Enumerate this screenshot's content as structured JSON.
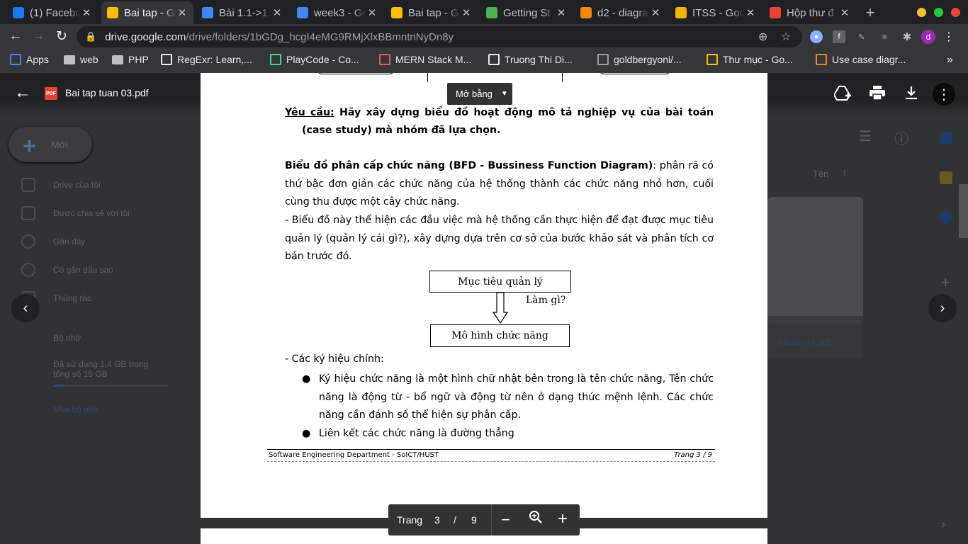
{
  "tabs": [
    {
      "title": "(1) Facebo",
      "icon": "facebook-icon",
      "color": "#1877f2"
    },
    {
      "title": "Bai tap - G",
      "icon": "google-drive-icon",
      "color": "#fbbc04",
      "active": true
    },
    {
      "title": "Bài 1.1->1.",
      "icon": "google-docs-icon",
      "color": "#4285f4"
    },
    {
      "title": "week3 - Go",
      "icon": "google-docs-icon",
      "color": "#4285f4"
    },
    {
      "title": "Bai tap - G",
      "icon": "google-drive-icon",
      "color": "#fbbc04"
    },
    {
      "title": "Getting St",
      "icon": "leaf-icon",
      "color": "#4caf50"
    },
    {
      "title": "d2 - diagra",
      "icon": "drawio-icon",
      "color": "#f08705"
    },
    {
      "title": "ITSS - Goo",
      "icon": "google-slides-icon",
      "color": "#f4b400"
    },
    {
      "title": "Hộp thư đ",
      "icon": "gmail-icon",
      "color": "#ea4335"
    }
  ],
  "address": {
    "url_host": "drive.google.com",
    "url_path": "/drive/folders/1bGDg_hcgI4eMG9RMjXlxBBmntnNyDn8y"
  },
  "bookmarks": [
    {
      "label": "Apps",
      "icon": "apps-grid-icon"
    },
    {
      "label": "web",
      "icon": "folder-icon"
    },
    {
      "label": "PHP",
      "icon": "folder-icon"
    },
    {
      "label": "RegExr: Learn,...",
      "icon": "regexr-icon"
    },
    {
      "label": "PlayCode - Co...",
      "icon": "playcode-icon"
    },
    {
      "label": "MERN Stack M...",
      "icon": "udemy-icon"
    },
    {
      "label": "Truong Thi Di...",
      "icon": "globe-icon"
    },
    {
      "label": "goldbergyoni/...",
      "icon": "github-icon"
    },
    {
      "label": "Thư mục - Go...",
      "icon": "google-drive-icon"
    },
    {
      "label": "Use case diagr...",
      "icon": "lucidchart-icon"
    }
  ],
  "viewer": {
    "file_name": "Bai tap tuan 03.pdf",
    "open_with": "Mở bằng"
  },
  "drive_sidebar": {
    "new_label": "Mới",
    "items": [
      "Drive của tôi",
      "Được chia sẻ với tôi",
      "Gần đây",
      "Có gắn dấu sao",
      "Thùng rác"
    ],
    "storage_label": "Bộ nhớ",
    "storage_text": "Đã sử dụng 1,4 GB trong tổng số 15 GB",
    "buy_storage": "Mua bộ nhớ",
    "storage_fraction": 0.093
  },
  "drive_main": {
    "sort_label": "Tên",
    "file_caption": "p tuan 03.pdf"
  },
  "pdf": {
    "req_label": "Yêu cầu:",
    "req_text": " Hãy xây dựng biểu đồ hoạt động mô tả nghiệp vụ của bài toán (case study) mà nhóm đã lựa chọn.",
    "bfd_title": "Biểu đồ phân cấp chức năng (BFD - Bussiness Function Diagram)",
    "bfd_text": ": phân rã có thứ bậc đơn giản các chức năng của hệ thống thành các chức năng nhỏ hơn, cuối cùng thu được một cây chức năng.",
    "para2": "- Biểu đồ này thể hiện các đầu việc mà hệ thống cần thực hiện để đạt được mục tiêu quản lý (quản lý cái gì?), xây dựng dựa trên cơ sở của bước khảo sát và phân tích cơ bản trước đó.",
    "fig_top": "Mục tiêu quản lý",
    "fig_label": "Làm gì?",
    "fig_bottom": "Mô hình chức năng",
    "symbols_title": "- Các ký hiệu chính:",
    "bullet1": "Ký hiệu chức năng là một hình chữ nhật bên trong là tên chức năng, Tên chức năng là động từ - bổ ngữ và động từ nên ở dạng thức mệnh lệnh. Các chức năng cần đánh số thể hiện sự phân cấp.",
    "bullet2": "Liên kết các chức năng là đường thẳng",
    "footer_left": "Software Engineering Department - SoICT/HUST",
    "footer_right": "Trang 3 / 9"
  },
  "pager": {
    "label": "Trang",
    "current": "3",
    "sep": "/",
    "total": "9"
  },
  "profile_initial": "d"
}
